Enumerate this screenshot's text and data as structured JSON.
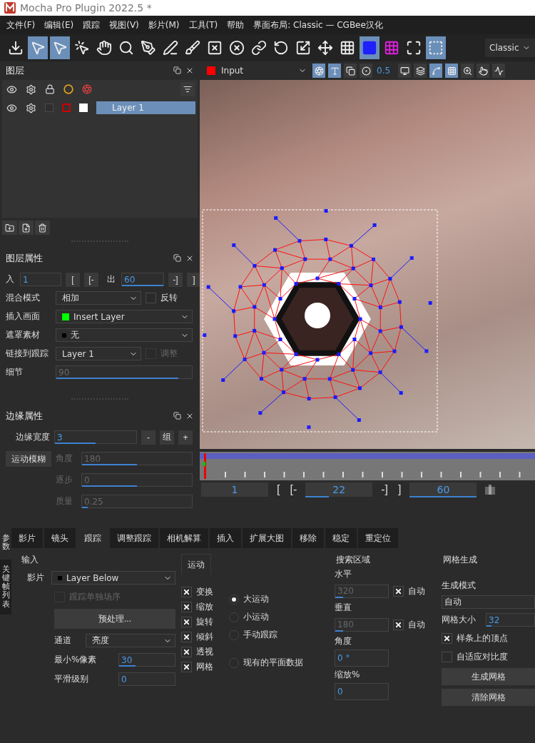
{
  "window": {
    "title": "Mocha Pro Plugin 2022.5 *"
  },
  "menu": [
    "文件(F)",
    "编辑(E)",
    "跟踪",
    "视图(V)",
    "影片(M)",
    "工具(T)",
    "帮助",
    "界面布局: Classic — CGBee汉化"
  ],
  "toolbar": {
    "tools": [
      {
        "selected": false
      },
      {
        "selected": true
      },
      {
        "selected": true
      },
      {
        "selected": false
      },
      {
        "selected": false
      },
      {
        "selected": false
      },
      {
        "selected": false
      },
      {
        "selected": false
      },
      {
        "selected": false
      },
      {
        "selected": false
      },
      {
        "selected": false
      },
      {
        "selected": false
      },
      {
        "selected": false
      },
      {
        "selected": false
      },
      {
        "selected": false
      },
      {
        "selected": false
      },
      {
        "selected": true
      },
      {
        "selected": false
      },
      {
        "selected": false
      },
      {
        "selected": true
      }
    ],
    "layout": "Classic"
  },
  "layers_panel": {
    "title": "图层",
    "layers": [
      {
        "name": "Layer 1",
        "selected": true
      }
    ]
  },
  "layer_properties": {
    "title": "图层属性",
    "in_label": "入",
    "in_value": "1",
    "in_buttons": [
      "[",
      "[-"
    ],
    "out_label": "出",
    "out": {
      "value": "60",
      "level": 1
    },
    "out_buttons": [
      "-]",
      "]"
    ],
    "rows": [
      {
        "kind": "select",
        "label": "混合模式",
        "value": "相加",
        "check": {
          "label": "反转",
          "checked": false,
          "disabled": false
        }
      },
      {
        "kind": "select",
        "label": "插入画面",
        "value": "Insert Layer",
        "color": "#00ff00"
      },
      {
        "kind": "select",
        "label": "遮罩素材",
        "value": "无",
        "color": "#000000"
      },
      {
        "kind": "select",
        "label": "链接到跟踪",
        "value": "Layer 1",
        "check": {
          "label": "调整",
          "checked": false,
          "disabled": true
        }
      },
      {
        "kind": "slider",
        "label": "细节",
        "value": "90",
        "level": 0.9,
        "disabled": true
      }
    ]
  },
  "edge_properties": {
    "title": "边缘属性",
    "width_label": "边缘宽度",
    "width": {
      "value": "3",
      "level": 0.5
    },
    "buttons": [
      "-",
      "组",
      "+"
    ],
    "motion_blur": "运动模糊",
    "rows": [
      {
        "label": "角度",
        "value": "180",
        "level": 0.5,
        "disabled": true
      },
      {
        "label": "逐步",
        "value": "0",
        "level": 0.5,
        "disabled": true
      },
      {
        "label": "质量",
        "value": "0.25",
        "level": 0.05,
        "disabled": true
      }
    ]
  },
  "viewer": {
    "clip": {
      "label": "Input",
      "color": "#ff0000"
    },
    "opacity": "0.5",
    "tools": [
      {
        "selected": true
      },
      {
        "selected": true
      },
      {
        "selected": false
      },
      {
        "selected": false
      },
      {
        "selected": false
      },
      {
        "selected": false
      },
      {
        "selected": true
      },
      {
        "selected": true
      },
      {
        "selected": false
      },
      {
        "selected": false
      },
      {
        "selected": false
      }
    ],
    "frames": {
      "start": "1",
      "in_buttons": [
        "[",
        "[-"
      ],
      "current": {
        "value": "22",
        "level": 0.35
      },
      "out_buttons": [
        "-]",
        "]"
      ],
      "end": {
        "value": "60",
        "level": 1
      }
    }
  },
  "bottom": {
    "side_tabs": [
      {
        "label": "参数",
        "selected": true
      },
      {
        "label": "关键帧列表",
        "selected": false
      }
    ],
    "tabs": [
      {
        "label": "影片",
        "selected": false
      },
      {
        "label": "镜头",
        "selected": false
      },
      {
        "label": "跟踪",
        "selected": true
      },
      {
        "label": "调整跟踪",
        "selected": false
      },
      {
        "label": "相机解算",
        "selected": false
      },
      {
        "label": "插入",
        "selected": false
      },
      {
        "label": "扩展大图",
        "selected": false
      },
      {
        "label": "移除",
        "selected": false
      },
      {
        "label": "稳定",
        "selected": false
      },
      {
        "label": "重定位",
        "selected": false
      }
    ],
    "input": {
      "title": "输入",
      "clip_label": "影片",
      "clip": {
        "value": "Layer Below",
        "color": "#000000"
      },
      "field_check": {
        "label": "跟踪单独场序",
        "checked": false,
        "disabled": true
      },
      "preprocess": "预处理...",
      "channel_label": "通道",
      "channel": "亮度",
      "min_pixels_label": "最小%像素",
      "min_pixels": {
        "value": "30",
        "level": 0.3
      },
      "smooth_label": "平滑级别",
      "smooth": "0"
    },
    "motion": {
      "tab": "运动",
      "checks": [
        {
          "label": "变换",
          "checked": true
        },
        {
          "label": "缩放",
          "checked": true
        },
        {
          "label": "旋转",
          "checked": true
        },
        {
          "label": "倾斜",
          "checked": true
        },
        {
          "label": "透视",
          "checked": true
        },
        {
          "label": "网格",
          "checked": true
        }
      ],
      "radios": [
        {
          "label": "大运动",
          "selected": true
        },
        {
          "label": "小运动",
          "selected": false
        },
        {
          "label": "手动跟踪",
          "selected": false
        }
      ],
      "existing": {
        "label": "现有的平面数据",
        "selected": false
      }
    },
    "search": {
      "title": "搜索区域",
      "horizontal_label": "水平",
      "horizontal": {
        "value": "320",
        "level": 0.15
      },
      "horizontal_auto": {
        "label": "自动",
        "checked": true
      },
      "vertical_label": "垂直",
      "vertical": {
        "value": "180",
        "level": 0.15
      },
      "vertical_auto": {
        "label": "自动",
        "checked": true
      },
      "angle_label": "角度",
      "angle": "0 °",
      "zoom_label": "缩放%",
      "zoom": "0"
    },
    "mesh": {
      "title": "网格生成",
      "mode_label": "生成模式",
      "mode": "自动",
      "size_label": "网格大小",
      "size": {
        "value": "32",
        "level": 0.1
      },
      "checks": [
        {
          "label": "样条上的顶点",
          "checked": true
        },
        {
          "label": "自适应对比度",
          "checked": false
        }
      ],
      "buttons": [
        "生成网格",
        "清除网格"
      ]
    }
  }
}
